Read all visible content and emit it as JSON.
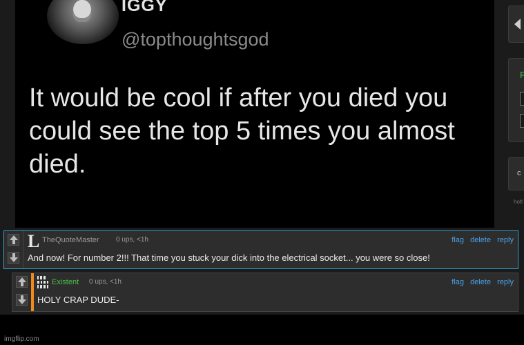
{
  "tweet": {
    "name": "IGGY",
    "handle": "@topthoughtsgod",
    "text": "It would be cool if after you died you could see the top 5 times you almost died."
  },
  "sidebar": {
    "green_label": "F",
    "box3_label": "c",
    "small_text": "hotl"
  },
  "comments": [
    {
      "avatar_text": "L",
      "username": "TheQuoteMaster",
      "meta": "0 ups, <1h",
      "flag": "flag",
      "delete": "delete",
      "reply": "reply",
      "body": "And now! For number 2!!! That time you stuck your dick into the electrical socket... you were so close!"
    },
    {
      "avatar_text": "100↑\n0100\n100↓",
      "username": "Existent",
      "meta": "0 ups, <1h",
      "flag": "flag",
      "delete": "delete",
      "reply": "reply",
      "body": "HOLY CRAP DUDE-",
      "accent_color": "#f08a1c"
    }
  ],
  "footer": {
    "watermark": "imgflip.com"
  }
}
